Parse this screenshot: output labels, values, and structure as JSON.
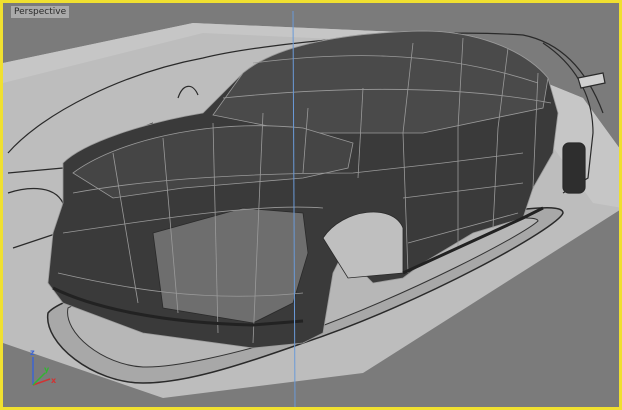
{
  "viewport": {
    "label": "Perspective",
    "border_color": "#f0e030",
    "active": true
  },
  "gizmo": {
    "x_label": "x",
    "y_label": "y",
    "z_label": "z",
    "x_color": "#d23232",
    "y_color": "#32b432",
    "z_color": "#3c64d2"
  },
  "scene": {
    "background_color": "#7b7b7b",
    "floor_color": "#bdbdbd",
    "wall_color": "#bcbcbc",
    "mesh_color": "#3a3a3a",
    "guide_line_color": "#6a9ad8"
  }
}
